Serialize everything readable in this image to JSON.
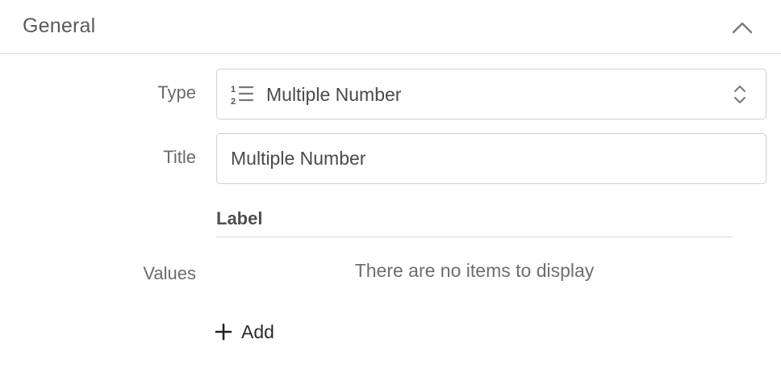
{
  "section": {
    "title": "General",
    "collapse_icon": "chevron-up-icon"
  },
  "fields": {
    "type": {
      "label": "Type",
      "value": "Multiple Number",
      "icon": "numbered-list-icon",
      "control_icon": "up-down-chevron-icon"
    },
    "title": {
      "label": "Title",
      "value": "Multiple Number"
    },
    "values": {
      "label": "Values",
      "column_header": "Label",
      "empty_message": "There are no items to display",
      "add_label": "Add",
      "add_icon": "plus-icon"
    }
  },
  "colors": {
    "border": "#cfcfcf",
    "text": "#4a4a4a",
    "muted_text": "#6b6b6b"
  }
}
